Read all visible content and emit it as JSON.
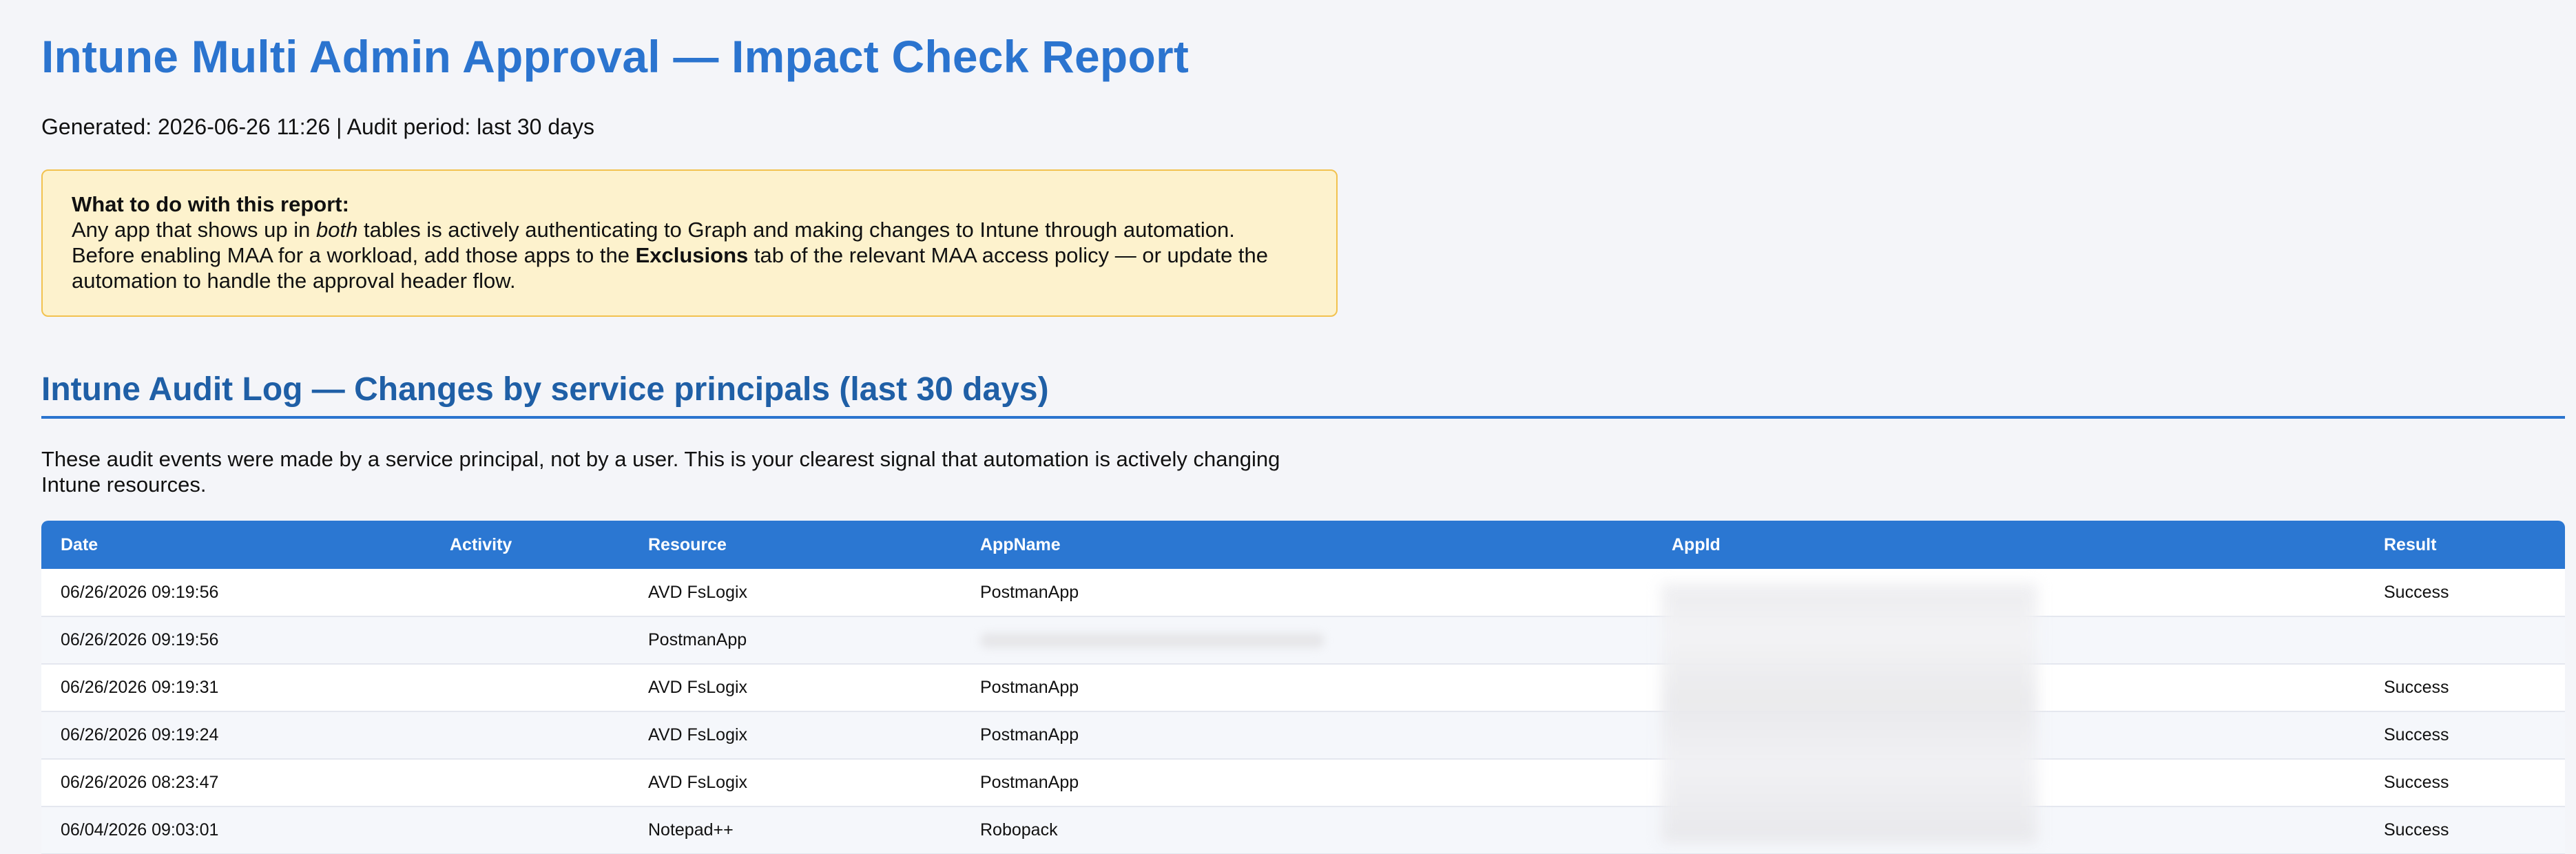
{
  "report": {
    "title": "Intune Multi Admin Approval — Impact Check Report",
    "generated_line": "Generated: 2026-06-26 11:26 | Audit period: last 30 days"
  },
  "callout": {
    "title": "What to do with this report:",
    "line1_pre": "Any app that shows up in ",
    "line1_em": "both",
    "line1_post": " tables is actively authenticating to Graph and making changes to Intune through automation.",
    "line2_pre": "Before enabling MAA for a workload, add those apps to the ",
    "line2_strong": "Exclusions",
    "line2_post": " tab of the relevant MAA access policy — or update the automation to handle the approval header flow."
  },
  "audit_section": {
    "title": "Intune Audit Log — Changes by service principals (last 30 days)",
    "description": "These audit events were made by a service principal, not by a user. This is your clearest signal that automation is actively changing Intune resources.",
    "columns": [
      "Date",
      "Activity",
      "Resource",
      "AppName",
      "AppId",
      "Result"
    ],
    "rows": [
      {
        "date": "06/26/2026 09:19:56",
        "activity": "",
        "resource": "AVD FsLogix",
        "appname": "PostmanApp",
        "appid": "",
        "result": "Success"
      },
      {
        "date": "06/26/2026 09:19:56",
        "activity": "",
        "resource": "PostmanApp",
        "appname": "",
        "appid": "",
        "result": ""
      },
      {
        "date": "06/26/2026 09:19:31",
        "activity": "",
        "resource": "AVD FsLogix",
        "appname": "PostmanApp",
        "appid": "",
        "result": "Success"
      },
      {
        "date": "06/26/2026 09:19:24",
        "activity": "",
        "resource": "AVD FsLogix",
        "appname": "PostmanApp",
        "appid": "",
        "result": "Success"
      },
      {
        "date": "06/26/2026 08:23:47",
        "activity": "",
        "resource": "AVD FsLogix",
        "appname": "PostmanApp",
        "appid": "",
        "result": "Success"
      },
      {
        "date": "06/04/2026 09:03:01",
        "activity": "",
        "resource": "Notepad++",
        "appname": "Robopack",
        "appid": "",
        "result": "Success"
      }
    ]
  }
}
